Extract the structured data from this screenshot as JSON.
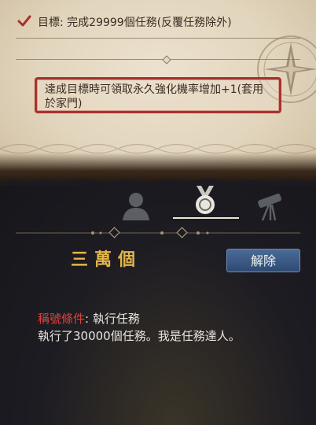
{
  "goal": {
    "label": "目標:",
    "text": "完成29999個任務(反覆任務除外)"
  },
  "reward": {
    "text": "達成目標時可領取永久強化機率增加+1(套用於家門)"
  },
  "tabs": [
    {
      "icon": "person-icon"
    },
    {
      "icon": "medal-icon",
      "selected": true
    },
    {
      "icon": "telescope-icon"
    }
  ],
  "title": {
    "name": "三萬個",
    "unlock_label": "解除",
    "condition_label": "稱號條件",
    "condition_sep": ":",
    "condition_value": " 執行任務",
    "description": "執行了30000個任務。我是任務達人。"
  },
  "colors": {
    "title": "#e3b54a",
    "condition_label": "#e0433a",
    "reward_border": "#a8312c",
    "button": "#3b5a86"
  }
}
